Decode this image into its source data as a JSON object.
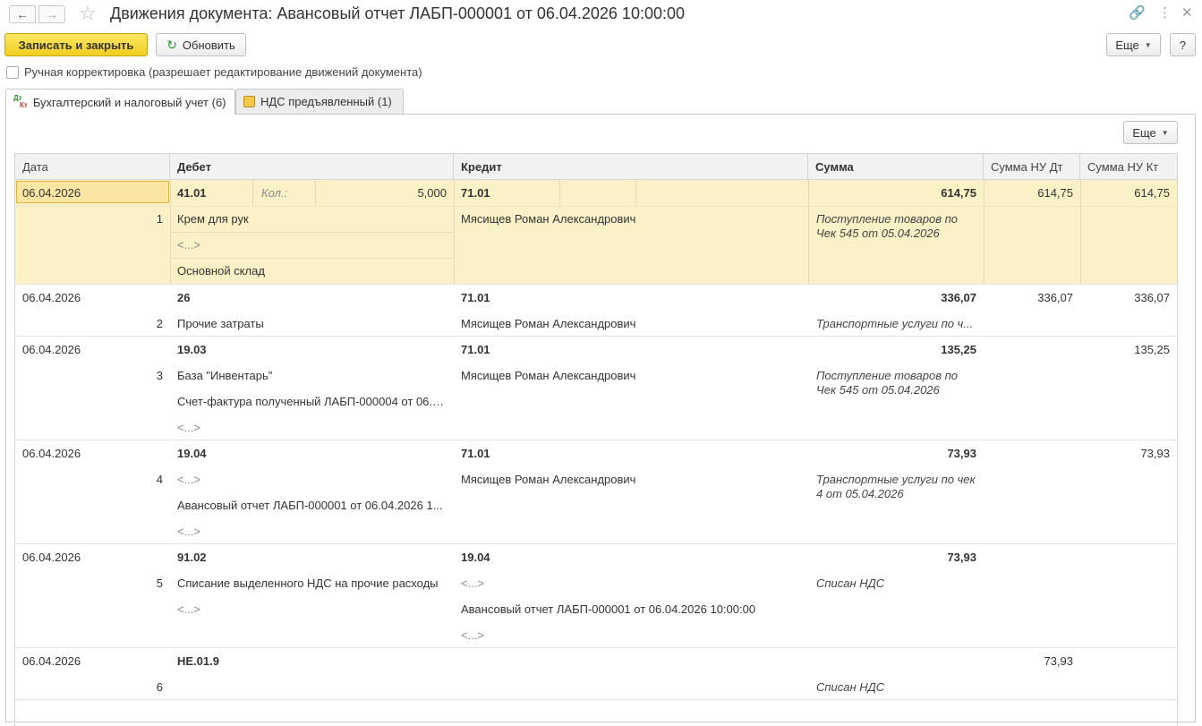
{
  "window": {
    "title": "Движения документа: Авансовый отчет ЛАБП-000001 от 06.04.2026 10:00:00",
    "icons": [
      "arrow-left-icon",
      "arrow-right-icon",
      "star-icon",
      "link-icon",
      "more-vertical-icon",
      "close-icon"
    ]
  },
  "toolbar": {
    "save_close": "Записать и закрыть",
    "refresh": "Обновить",
    "more": "Еще",
    "help": "?"
  },
  "manual_correction": {
    "label": "Ручная корректировка (разрешает редактирование движений документа)",
    "checked": false
  },
  "tabs": [
    {
      "label": "Бухгалтерский и налоговый учет (6)",
      "icon_top": "Дт",
      "icon_bottom": "Кт",
      "active": true
    },
    {
      "label": "НДС предъявленный (1)",
      "active": false
    }
  ],
  "grid": {
    "more": "Еще",
    "columns": [
      "Дата",
      "Дебет",
      "Кредит",
      "Сумма",
      "Сумма НУ Дт",
      "Сумма НУ Кт"
    ],
    "qty_label": "Кол.:",
    "rows": [
      {
        "date": "06.04.2026",
        "num": "1",
        "debit_account": "41.01",
        "debit_qty": "5,000",
        "debit_sub": [
          "Крем для рук",
          "<...>",
          "Основной склад"
        ],
        "credit_account": "71.01",
        "credit_sub": [
          "Мясищев Роман Александрович"
        ],
        "sum": "614,75",
        "content": "Поступление товаров по Чек 545 от 05.04.2026",
        "sum_nu_dt": "614,75",
        "sum_nu_kt": "614,75",
        "selected": true
      },
      {
        "date": "06.04.2026",
        "num": "2",
        "debit_account": "26",
        "debit_sub": [
          "Прочие затраты"
        ],
        "credit_account": "71.01",
        "credit_sub": [
          "Мясищев Роман Александрович"
        ],
        "sum": "336,07",
        "content": "Транспортные услуги по ч...",
        "sum_nu_dt": "336,07",
        "sum_nu_kt": "336,07"
      },
      {
        "date": "06.04.2026",
        "num": "3",
        "debit_account": "19.03",
        "debit_sub": [
          "База \"Инвентарь\"",
          "Счет-фактура полученный ЛАБП-000004 от 06.0...",
          "<...>"
        ],
        "credit_account": "71.01",
        "credit_sub": [
          "Мясищев Роман Александрович"
        ],
        "sum": "135,25",
        "content": "Поступление товаров по Чек 545 от 05.04.2026",
        "sum_nu_dt": "",
        "sum_nu_kt": "135,25"
      },
      {
        "date": "06.04.2026",
        "num": "4",
        "debit_account": "19.04",
        "debit_sub": [
          "<...>",
          "Авансовый отчет ЛАБП-000001 от 06.04.2026 1...",
          "<...>"
        ],
        "credit_account": "71.01",
        "credit_sub": [
          "Мясищев Роман Александрович"
        ],
        "sum": "73,93",
        "content": "Транспортные услуги по чек 4 от 05.04.2026",
        "sum_nu_dt": "",
        "sum_nu_kt": "73,93"
      },
      {
        "date": "06.04.2026",
        "num": "5",
        "debit_account": "91.02",
        "debit_sub": [
          "Списание выделенного НДС на прочие расходы",
          "<...>"
        ],
        "credit_account": "19.04",
        "credit_sub": [
          "<...>",
          "Авансовый отчет ЛАБП-000001 от 06.04.2026 10:00:00",
          "<...>"
        ],
        "sum": "73,93",
        "content": "Списан НДС",
        "sum_nu_dt": "",
        "sum_nu_kt": ""
      },
      {
        "date": "06.04.2026",
        "num": "6",
        "debit_account": "НЕ.01.9",
        "debit_sub": [],
        "credit_account": "",
        "credit_sub": [],
        "sum": "",
        "content": "Списан НДС",
        "sum_nu_dt": "73,93",
        "sum_nu_kt": ""
      }
    ]
  }
}
